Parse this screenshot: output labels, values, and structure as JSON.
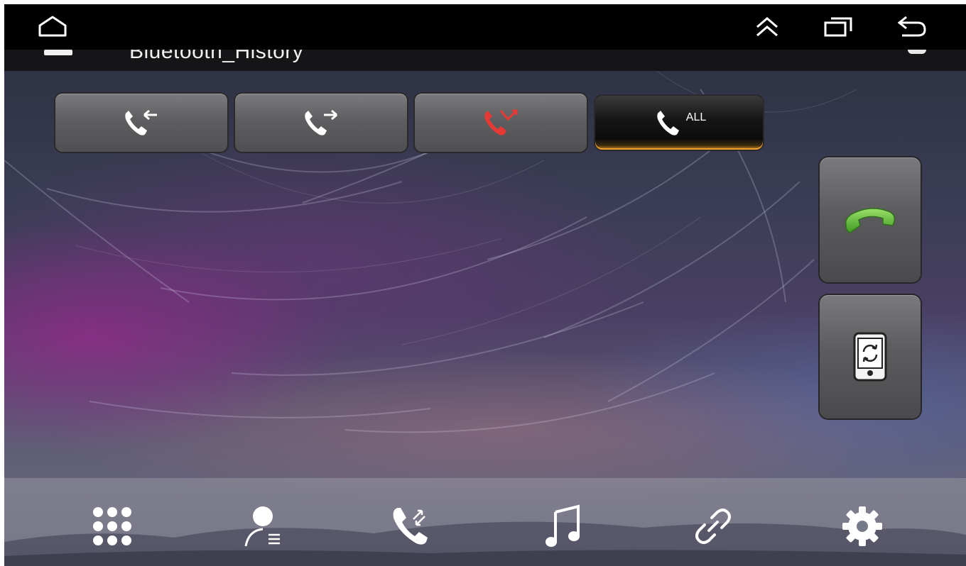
{
  "app": {
    "title": "Bluetooth_History"
  },
  "system_bar": {
    "icons": [
      "home-icon",
      "expand-up-icon",
      "recents-icon",
      "back-icon"
    ]
  },
  "call_filter_tabs": [
    {
      "name": "incoming-calls",
      "icon": "incoming-call-icon",
      "label": "",
      "active": false
    },
    {
      "name": "outgoing-calls",
      "icon": "outgoing-call-icon",
      "label": "",
      "active": false
    },
    {
      "name": "missed-calls",
      "icon": "missed-call-icon",
      "label": "",
      "active": false
    },
    {
      "name": "all-calls",
      "icon": "all-calls-icon",
      "label": "ALL",
      "active": true
    }
  ],
  "side_buttons": [
    {
      "name": "dial-call-button",
      "icon": "green-phone-icon"
    },
    {
      "name": "sync-phone-button",
      "icon": "phone-sync-icon"
    }
  ],
  "dock": {
    "items": [
      {
        "name": "dock-dialpad",
        "icon": "dialpad-icon"
      },
      {
        "name": "dock-contacts",
        "icon": "contacts-icon"
      },
      {
        "name": "dock-call-history",
        "icon": "call-history-icon",
        "active": true
      },
      {
        "name": "dock-music",
        "icon": "music-note-icon"
      },
      {
        "name": "dock-connection",
        "icon": "link-icon"
      },
      {
        "name": "dock-settings",
        "icon": "gear-icon"
      }
    ]
  },
  "colors": {
    "missed_call": "#e53935",
    "call_button": "#66c23a",
    "active_tab_glow": "#f0a030"
  }
}
